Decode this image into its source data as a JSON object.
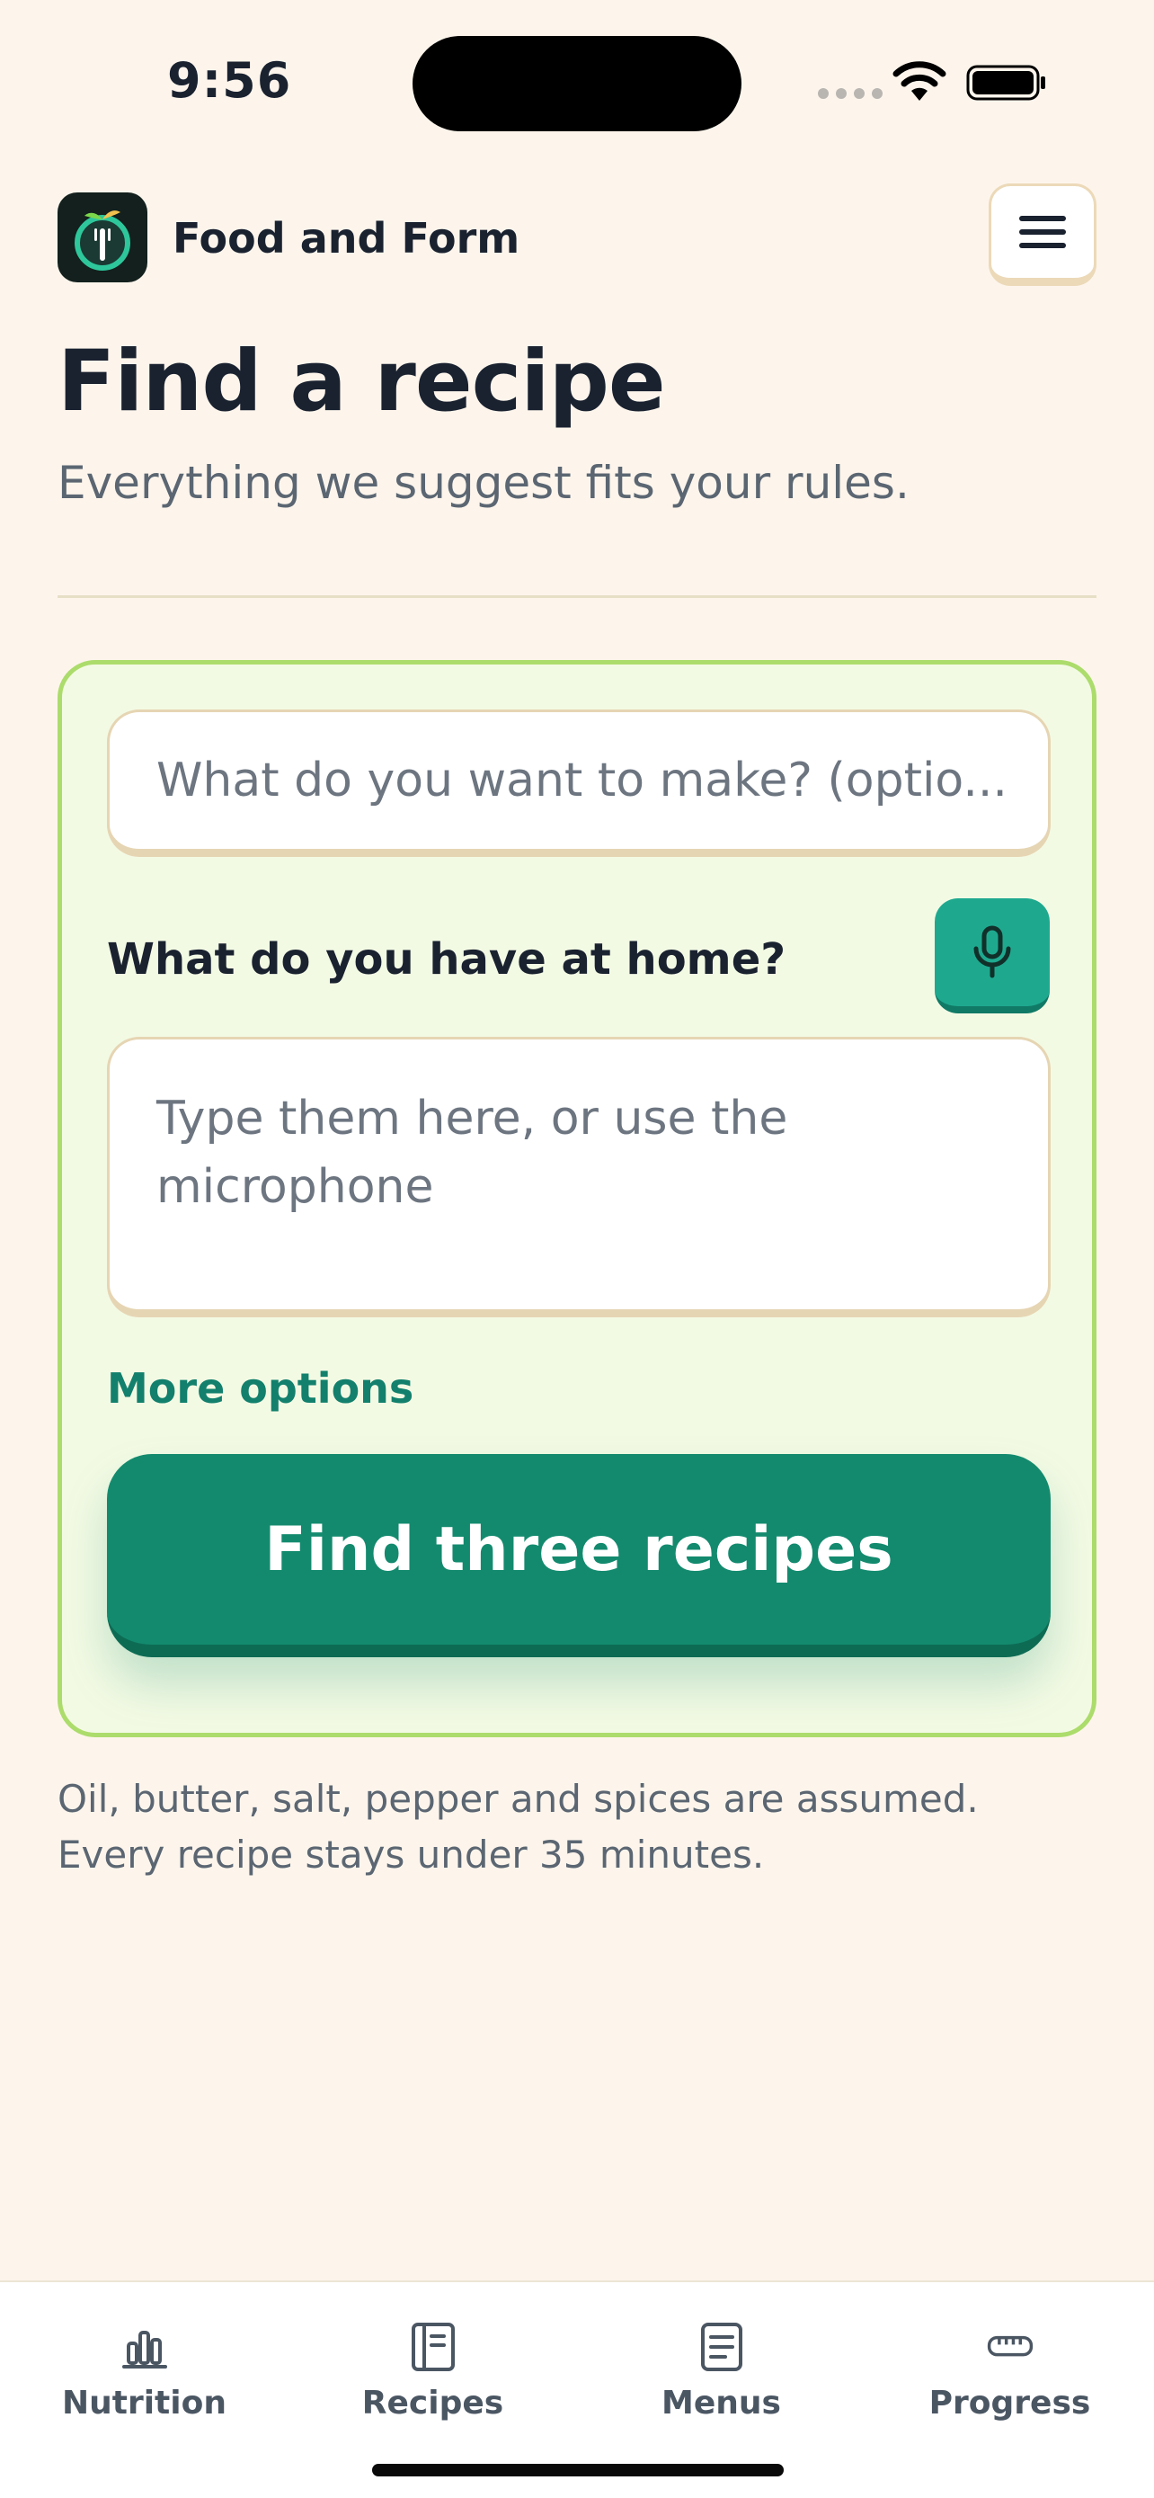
{
  "status_bar": {
    "time": "9:56"
  },
  "header": {
    "app_name": "Food and Form",
    "logo_icon": "apple-fork-icon",
    "menu_icon": "hamburger-menu-icon"
  },
  "page": {
    "title": "Find a recipe",
    "subtitle": "Everything we suggest fits your rules."
  },
  "form": {
    "dish_input_placeholder": "What do you want to make? (optio...",
    "ingredients_label": "What do you have at home?",
    "ingredients_placeholder": "Type them here, or use the microphone",
    "more_options_label": "More options",
    "submit_label": "Find three recipes"
  },
  "note": "Oil, butter, salt, pepper and spices are assumed. Every recipe stays under 35 minutes.",
  "tabs": [
    {
      "label": "Nutrition",
      "icon": "bar-chart-icon"
    },
    {
      "label": "Recipes",
      "icon": "book-icon"
    },
    {
      "label": "Menus",
      "icon": "document-icon"
    },
    {
      "label": "Progress",
      "icon": "ruler-icon"
    }
  ],
  "colors": {
    "background": "#fdf5ec",
    "card_bg": "#f3fae4",
    "card_border": "#acdc6b",
    "accent_green": "#138a6e",
    "mic_teal": "#1ea98f",
    "link_green": "#12806c"
  }
}
